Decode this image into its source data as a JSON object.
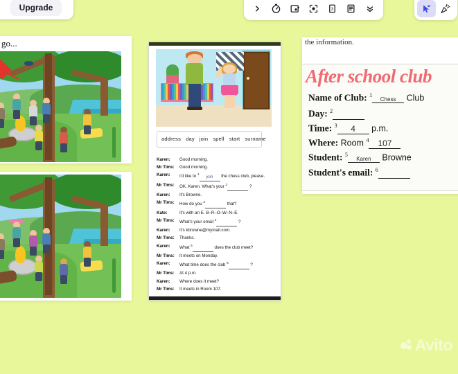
{
  "app": {
    "background_color": "#e9f79b",
    "upgrade_label": "Upgrade"
  },
  "toolbar": {
    "items": [
      {
        "icon": "chevron-right-icon",
        "label": ">"
      },
      {
        "icon": "timer-icon",
        "label": "Timer"
      },
      {
        "icon": "image-spotlight-icon",
        "label": "Spotlight"
      },
      {
        "icon": "focus-frame-icon",
        "label": "Focus"
      },
      {
        "icon": "number-card-icon",
        "label": "3"
      },
      {
        "icon": "list-icon",
        "label": "List"
      },
      {
        "icon": "chevron-double-down-icon",
        "label": "More"
      }
    ],
    "right_items": [
      {
        "icon": "cursor-icon",
        "label": "Pointer",
        "active": true
      },
      {
        "icon": "confetti-icon",
        "label": "Confetti",
        "active": false
      }
    ]
  },
  "left_sheet": {
    "instruction_fragment": "go...",
    "top_image_alt": "Children camping by a river under a big tree, kite in sky",
    "bottom_image_alt": "Same camping scene with spot-the-difference changes"
  },
  "middle_sheet": {
    "scene_alt": "Teacher with tablet talking to a girl in a school library",
    "word_bank": [
      "address",
      "day",
      "join",
      "spell",
      "start",
      "surname"
    ],
    "dialogue": [
      {
        "speaker": "Karen:",
        "parts": [
          {
            "t": "Good morning."
          }
        ]
      },
      {
        "speaker": "Mr Tims:",
        "parts": [
          {
            "t": "Good morning."
          }
        ]
      },
      {
        "speaker": "Karen:",
        "parts": [
          {
            "t": "I'd like to "
          },
          {
            "sup": "1"
          },
          {
            "blank": "join",
            "filled": true
          },
          {
            "t": " the chess club, please."
          }
        ]
      },
      {
        "speaker": "Mr Tims:",
        "parts": [
          {
            "t": "OK, Karen. What's your "
          },
          {
            "sup": "2"
          },
          {
            "blank": "",
            "filled": false
          },
          {
            "t": " ?"
          }
        ]
      },
      {
        "speaker": "Karen:",
        "parts": [
          {
            "t": "It's Browne."
          }
        ]
      },
      {
        "speaker": "Mr Tims:",
        "parts": [
          {
            "t": "How do you "
          },
          {
            "sup": "3"
          },
          {
            "blank": "",
            "filled": false
          },
          {
            "t": " that?"
          }
        ]
      },
      {
        "speaker": "Kate:",
        "parts": [
          {
            "t": "It's with an E. B–R–O–W–N–E."
          }
        ]
      },
      {
        "speaker": "Mr Tims:",
        "parts": [
          {
            "t": "What's your email "
          },
          {
            "sup": "4"
          },
          {
            "blank": "",
            "filled": false
          },
          {
            "t": " ?"
          }
        ]
      },
      {
        "speaker": "Karen:",
        "parts": [
          {
            "t": "It's kbrowne@mymail.com."
          }
        ]
      },
      {
        "speaker": "Mr Tims:",
        "parts": [
          {
            "t": "Thanks."
          }
        ]
      },
      {
        "speaker": "Karen:",
        "parts": [
          {
            "t": "What "
          },
          {
            "sup": "5"
          },
          {
            "blank": "",
            "filled": false
          },
          {
            "t": " does the club meet?"
          }
        ]
      },
      {
        "speaker": "Mr Tims:",
        "parts": [
          {
            "t": "It meets on Monday."
          }
        ]
      },
      {
        "speaker": "Karen:",
        "parts": [
          {
            "t": "What time does the club "
          },
          {
            "sup": "6"
          },
          {
            "blank": "",
            "filled": false
          },
          {
            "t": " ?"
          }
        ]
      },
      {
        "speaker": "Mr Tims:",
        "parts": [
          {
            "t": "At 4 p.m."
          }
        ]
      },
      {
        "speaker": "Karen:",
        "parts": [
          {
            "t": "Where does it meet?"
          }
        ]
      },
      {
        "speaker": "Mr Tims:",
        "parts": [
          {
            "t": "It meets in Room 107."
          }
        ]
      }
    ]
  },
  "right_sheet": {
    "instruction_fragment": "the information.",
    "form_title": "After school club",
    "title_color": "#ef6a72",
    "fields": [
      {
        "label": "Name of Club:",
        "sup": "1",
        "value": "Chess",
        "suffix": "Club"
      },
      {
        "label": "Day:",
        "sup": "2",
        "value": "",
        "suffix": ""
      },
      {
        "label": "Time:",
        "sup": "3",
        "value": "4",
        "suffix": "p.m."
      },
      {
        "label": "Where:",
        "prefix": "Room",
        "sup": "4",
        "value": "107",
        "suffix": ""
      },
      {
        "label": "Student:",
        "sup": "5",
        "value": "Karen",
        "suffix": "Browne"
      },
      {
        "label": "Student's email:",
        "sup": "6",
        "value": "",
        "suffix": ""
      }
    ]
  },
  "watermark": {
    "text": "Avito"
  }
}
